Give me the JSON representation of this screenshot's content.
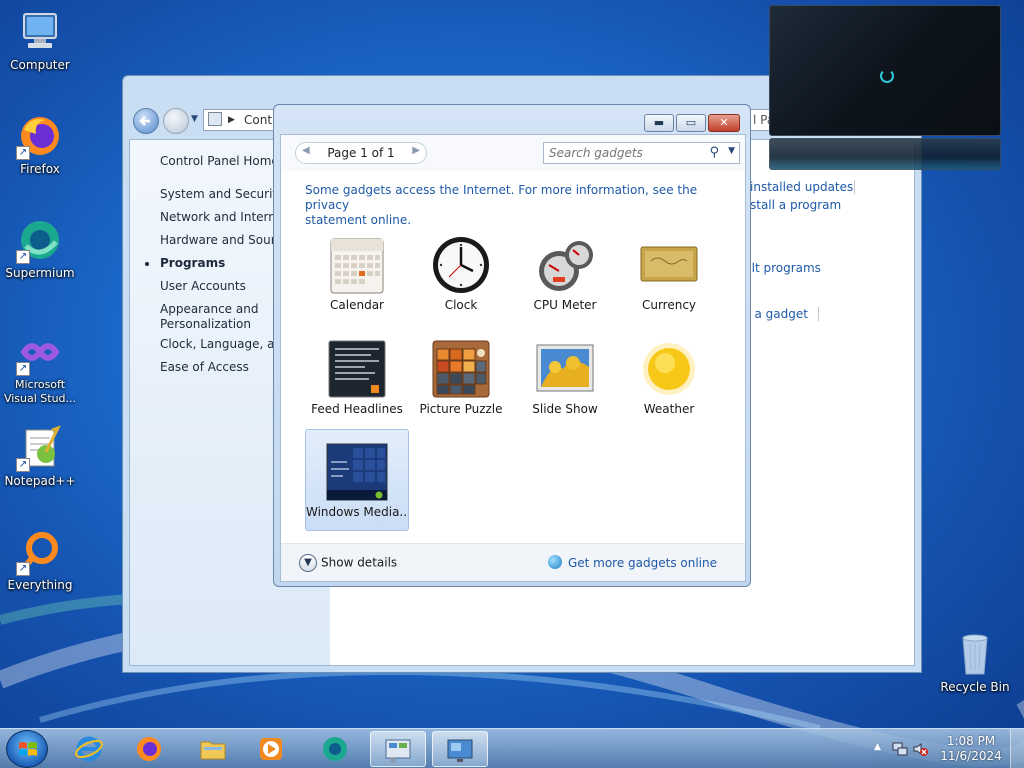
{
  "desktop": {
    "icons": [
      {
        "label": "Computer",
        "icon": "computer-icon"
      },
      {
        "label": "Firefox",
        "icon": "firefox-icon"
      },
      {
        "label": "Supermium",
        "icon": "supermium-icon"
      },
      {
        "label": "Microsoft Visual Stud...",
        "icon": "visual-studio-icon"
      },
      {
        "label": "Notepad++",
        "icon": "notepad-plus-plus-icon"
      },
      {
        "label": "Everything",
        "icon": "everything-search-icon"
      },
      {
        "label": "Recycle Bin",
        "icon": "recycle-bin-icon"
      }
    ]
  },
  "control_panel": {
    "address": "Contr",
    "sidebar": {
      "home": "Control Panel Home",
      "items": [
        "System and Security",
        "Network and Internet",
        "Hardware and Sound",
        "Programs",
        "User Accounts",
        "Appearance and Personalization",
        "Clock, Language, and",
        "Ease of Access"
      ]
    },
    "right_links": [
      "installed updates",
      "stall a program",
      "ult programs",
      "ll a gadget"
    ],
    "address_fragment": "l Pa"
  },
  "gadgets_dialog": {
    "pager": "Page 1 of 1",
    "search_placeholder": "Search gadgets",
    "info_line1": "Some gadgets access the Internet.  For more information, see the privacy",
    "info_line2": "statement online.",
    "gadgets": [
      {
        "label": "Calendar",
        "icon": "calendar-icon"
      },
      {
        "label": "Clock",
        "icon": "clock-icon"
      },
      {
        "label": "CPU Meter",
        "icon": "cpu-meter-icon"
      },
      {
        "label": "Currency",
        "icon": "currency-icon"
      },
      {
        "label": "Feed Headlines",
        "icon": "feed-headlines-icon"
      },
      {
        "label": "Picture Puzzle",
        "icon": "picture-puzzle-icon"
      },
      {
        "label": "Slide Show",
        "icon": "slide-show-icon"
      },
      {
        "label": "Weather",
        "icon": "weather-icon"
      },
      {
        "label": "Windows Media...",
        "icon": "windows-media-center-icon"
      }
    ],
    "show_details": "Show details",
    "more_online": "Get more gadgets online"
  },
  "taskbar": {
    "apps": [
      "internet-explorer",
      "firefox",
      "file-explorer",
      "media-player",
      "supermium",
      "control-panel",
      "gadgets"
    ],
    "time": "1:08 PM",
    "date": "11/6/2024"
  }
}
